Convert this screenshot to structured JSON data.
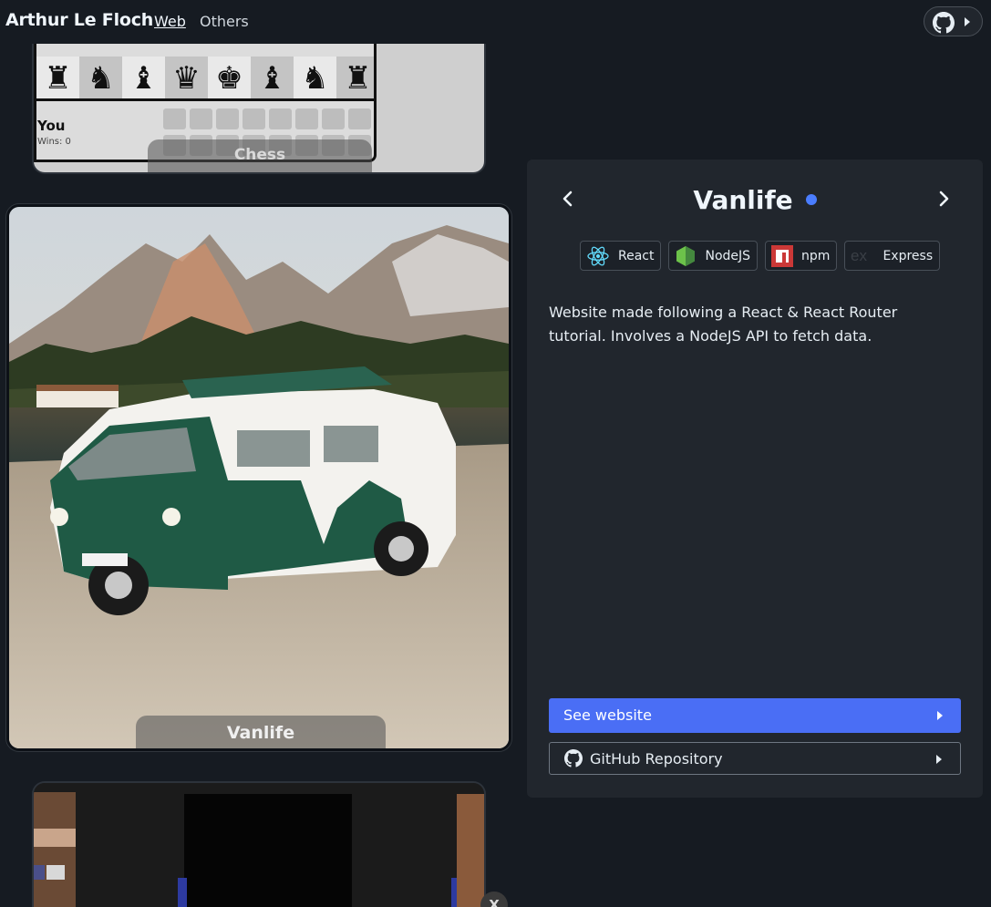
{
  "header": {
    "brand": "Arthur Le Floch",
    "nav": [
      {
        "label": "Web",
        "active": true
      },
      {
        "label": "Others",
        "active": false
      }
    ],
    "github_menu_icon": "github-icon"
  },
  "cards": {
    "chess": {
      "label": "Chess",
      "player_name": "You",
      "player_wins": "Wins: 0",
      "pawn_row": [
        "♟",
        "♟",
        "♟",
        "♟",
        "♟",
        "♟",
        "♟",
        "♟"
      ],
      "back_row": [
        "♜",
        "♞",
        "♝",
        "♛",
        "♚",
        "♝",
        "♞",
        "♜"
      ]
    },
    "vanlife": {
      "label": "Vanlife"
    },
    "next_card_close": "X"
  },
  "project": {
    "title": "Vanlife",
    "status_color": "#4a7dff",
    "tags": [
      {
        "label": "React",
        "icon": "react-icon"
      },
      {
        "label": "NodeJS",
        "icon": "nodejs-icon"
      },
      {
        "label": "npm",
        "icon": "npm-icon"
      },
      {
        "label": "Express",
        "icon": "express-icon"
      }
    ],
    "description": "Website made following a React & React Router tutorial. Involves a NodeJS API to fetch data.",
    "see_website": "See website",
    "github_repo": "GitHub Repository"
  },
  "colors": {
    "background": "#161b22",
    "panel": "#21262d",
    "primary": "#4a6ef5"
  }
}
